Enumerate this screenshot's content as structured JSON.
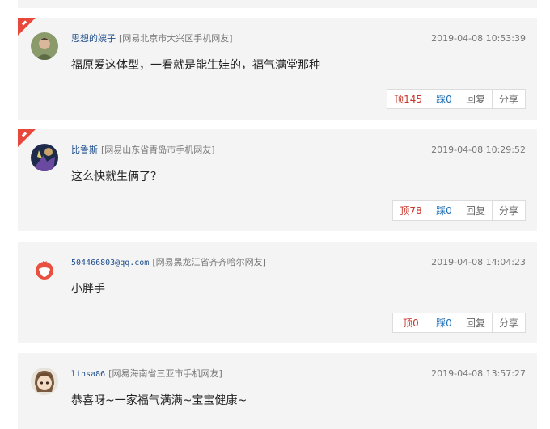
{
  "accent_hot": "#e8473b",
  "comments": [
    {
      "user": "思想的姨子",
      "location": "[网易北京市大兴区手机网友]",
      "time": "2019-04-08 10:53:39",
      "content": "福原爱这体型，一看就是能生娃的，福气满堂那种",
      "hot": true,
      "avatar_icon": "user-photo-avatar",
      "up_label": "顶145",
      "down_label": "踩0",
      "reply_label": "回复",
      "share_label": "分享"
    },
    {
      "user": "比鲁斯",
      "location": "[网易山东省青岛市手机网友]",
      "time": "2019-04-08 10:29:52",
      "content": "这么快就生俩了？",
      "hot": true,
      "avatar_icon": "anime-character-avatar",
      "up_label": "顶78",
      "down_label": "踩0",
      "reply_label": "回复",
      "share_label": "分享"
    },
    {
      "user": "504466803@qq.com",
      "location": "[网易黑龙江省齐齐哈尔网友]",
      "time": "2019-04-08 14:04:23",
      "content": "小胖手",
      "hot": false,
      "avatar_icon": "default-netease-avatar",
      "up_label": "顶0",
      "down_label": "踩0",
      "reply_label": "回复",
      "share_label": "分享"
    },
    {
      "user": "linsa86",
      "location": "[网易海南省三亚市手机网友]",
      "time": "2019-04-08 13:57:27",
      "content": "恭喜呀~一家福气满满~宝宝健康~",
      "hot": false,
      "avatar_icon": "anime-girl-avatar"
    }
  ]
}
